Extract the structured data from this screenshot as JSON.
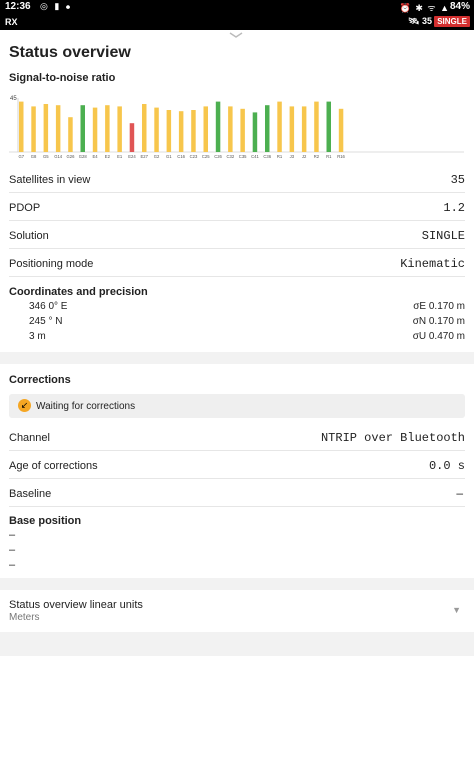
{
  "status_bar": {
    "time": "12:36",
    "battery": "84%"
  },
  "receiver_bar": {
    "rx_label": "RX",
    "sat_count": "35",
    "solution_badge": "SINGLE"
  },
  "title": "Status overview",
  "snr": {
    "heading": "Signal-to-noise ratio",
    "y_tick": "45",
    "colors": {
      "yellow": "#f7c64c",
      "green": "#4caf50",
      "red": "#e05555"
    }
  },
  "chart_data": {
    "type": "bar",
    "categories": [
      "G7",
      "G8",
      "G5",
      "G14",
      "G26",
      "G28",
      "E4",
      "E2",
      "E1",
      "E24",
      "E27",
      "G2",
      "G1",
      "C16",
      "C23",
      "C25",
      "C26",
      "C32",
      "C35",
      "C41",
      "C36",
      "R1",
      "J3",
      "J2",
      "R2",
      "R1",
      "R16"
    ],
    "values": [
      42,
      38,
      40,
      39,
      29,
      39,
      37,
      39,
      38,
      24,
      40,
      37,
      35,
      34,
      35,
      38,
      42,
      38,
      36,
      33,
      39,
      42,
      38,
      38,
      42,
      42,
      36
    ],
    "colors": [
      "yellow",
      "yellow",
      "yellow",
      "yellow",
      "yellow",
      "green",
      "yellow",
      "yellow",
      "yellow",
      "red",
      "yellow",
      "yellow",
      "yellow",
      "yellow",
      "yellow",
      "yellow",
      "green",
      "yellow",
      "yellow",
      "green",
      "green",
      "yellow",
      "yellow",
      "yellow",
      "yellow",
      "green",
      "yellow"
    ],
    "ylim": [
      0,
      45
    ],
    "title": "",
    "xlabel": "",
    "ylabel": ""
  },
  "rows": {
    "satellites": {
      "label": "Satellites in view",
      "value": "35"
    },
    "pdop": {
      "label": "PDOP",
      "value": "1.2"
    },
    "solution": {
      "label": "Solution",
      "value": "SINGLE"
    },
    "mode": {
      "label": "Positioning mode",
      "value": "Kinematic"
    }
  },
  "coords": {
    "heading": "Coordinates and precision",
    "lon": "346  0° E",
    "lat": "245  ° N",
    "alt": "3 m",
    "sigma_e": "σE 0.170 m",
    "sigma_n": "σN 0.170 m",
    "sigma_u": "σU 0.470 m"
  },
  "corrections": {
    "heading": "Corrections",
    "notice": "Waiting for corrections",
    "channel_label": "Channel",
    "channel_value": "NTRIP over Bluetooth",
    "age_label": "Age of corrections",
    "age_value": "0.0 s",
    "baseline_label": "Baseline",
    "baseline_value": "–"
  },
  "base_position": {
    "heading": "Base position",
    "line1": "–",
    "line2": "–",
    "line3": "–"
  },
  "units": {
    "label": "Status overview linear units",
    "value": "Meters"
  }
}
